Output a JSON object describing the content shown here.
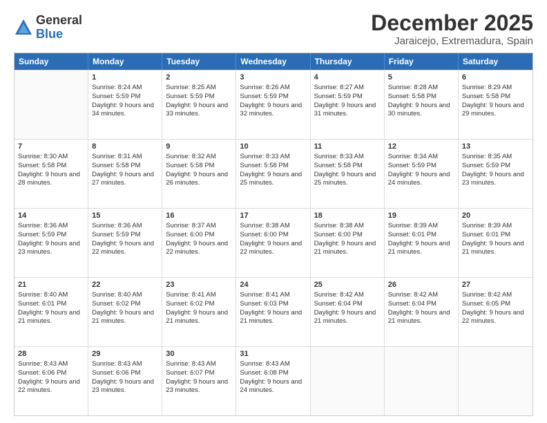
{
  "logo": {
    "general": "General",
    "blue": "Blue"
  },
  "title": "December 2025",
  "subtitle": "Jaraicejo, Extremadura, Spain",
  "days": [
    "Sunday",
    "Monday",
    "Tuesday",
    "Wednesday",
    "Thursday",
    "Friday",
    "Saturday"
  ],
  "weeks": [
    [
      {
        "day": "",
        "sunrise": "",
        "sunset": "",
        "daylight": ""
      },
      {
        "day": "1",
        "sunrise": "Sunrise: 8:24 AM",
        "sunset": "Sunset: 5:59 PM",
        "daylight": "Daylight: 9 hours and 34 minutes."
      },
      {
        "day": "2",
        "sunrise": "Sunrise: 8:25 AM",
        "sunset": "Sunset: 5:59 PM",
        "daylight": "Daylight: 9 hours and 33 minutes."
      },
      {
        "day": "3",
        "sunrise": "Sunrise: 8:26 AM",
        "sunset": "Sunset: 5:59 PM",
        "daylight": "Daylight: 9 hours and 32 minutes."
      },
      {
        "day": "4",
        "sunrise": "Sunrise: 8:27 AM",
        "sunset": "Sunset: 5:59 PM",
        "daylight": "Daylight: 9 hours and 31 minutes."
      },
      {
        "day": "5",
        "sunrise": "Sunrise: 8:28 AM",
        "sunset": "Sunset: 5:58 PM",
        "daylight": "Daylight: 9 hours and 30 minutes."
      },
      {
        "day": "6",
        "sunrise": "Sunrise: 8:29 AM",
        "sunset": "Sunset: 5:58 PM",
        "daylight": "Daylight: 9 hours and 29 minutes."
      }
    ],
    [
      {
        "day": "7",
        "sunrise": "Sunrise: 8:30 AM",
        "sunset": "Sunset: 5:58 PM",
        "daylight": "Daylight: 9 hours and 28 minutes."
      },
      {
        "day": "8",
        "sunrise": "Sunrise: 8:31 AM",
        "sunset": "Sunset: 5:58 PM",
        "daylight": "Daylight: 9 hours and 27 minutes."
      },
      {
        "day": "9",
        "sunrise": "Sunrise: 8:32 AM",
        "sunset": "Sunset: 5:58 PM",
        "daylight": "Daylight: 9 hours and 26 minutes."
      },
      {
        "day": "10",
        "sunrise": "Sunrise: 8:33 AM",
        "sunset": "Sunset: 5:58 PM",
        "daylight": "Daylight: 9 hours and 25 minutes."
      },
      {
        "day": "11",
        "sunrise": "Sunrise: 8:33 AM",
        "sunset": "Sunset: 5:58 PM",
        "daylight": "Daylight: 9 hours and 25 minutes."
      },
      {
        "day": "12",
        "sunrise": "Sunrise: 8:34 AM",
        "sunset": "Sunset: 5:59 PM",
        "daylight": "Daylight: 9 hours and 24 minutes."
      },
      {
        "day": "13",
        "sunrise": "Sunrise: 8:35 AM",
        "sunset": "Sunset: 5:59 PM",
        "daylight": "Daylight: 9 hours and 23 minutes."
      }
    ],
    [
      {
        "day": "14",
        "sunrise": "Sunrise: 8:36 AM",
        "sunset": "Sunset: 5:59 PM",
        "daylight": "Daylight: 9 hours and 23 minutes."
      },
      {
        "day": "15",
        "sunrise": "Sunrise: 8:36 AM",
        "sunset": "Sunset: 5:59 PM",
        "daylight": "Daylight: 9 hours and 22 minutes."
      },
      {
        "day": "16",
        "sunrise": "Sunrise: 8:37 AM",
        "sunset": "Sunset: 6:00 PM",
        "daylight": "Daylight: 9 hours and 22 minutes."
      },
      {
        "day": "17",
        "sunrise": "Sunrise: 8:38 AM",
        "sunset": "Sunset: 6:00 PM",
        "daylight": "Daylight: 9 hours and 22 minutes."
      },
      {
        "day": "18",
        "sunrise": "Sunrise: 8:38 AM",
        "sunset": "Sunset: 6:00 PM",
        "daylight": "Daylight: 9 hours and 21 minutes."
      },
      {
        "day": "19",
        "sunrise": "Sunrise: 8:39 AM",
        "sunset": "Sunset: 6:01 PM",
        "daylight": "Daylight: 9 hours and 21 minutes."
      },
      {
        "day": "20",
        "sunrise": "Sunrise: 8:39 AM",
        "sunset": "Sunset: 6:01 PM",
        "daylight": "Daylight: 9 hours and 21 minutes."
      }
    ],
    [
      {
        "day": "21",
        "sunrise": "Sunrise: 8:40 AM",
        "sunset": "Sunset: 6:01 PM",
        "daylight": "Daylight: 9 hours and 21 minutes."
      },
      {
        "day": "22",
        "sunrise": "Sunrise: 8:40 AM",
        "sunset": "Sunset: 6:02 PM",
        "daylight": "Daylight: 9 hours and 21 minutes."
      },
      {
        "day": "23",
        "sunrise": "Sunrise: 8:41 AM",
        "sunset": "Sunset: 6:02 PM",
        "daylight": "Daylight: 9 hours and 21 minutes."
      },
      {
        "day": "24",
        "sunrise": "Sunrise: 8:41 AM",
        "sunset": "Sunset: 6:03 PM",
        "daylight": "Daylight: 9 hours and 21 minutes."
      },
      {
        "day": "25",
        "sunrise": "Sunrise: 8:42 AM",
        "sunset": "Sunset: 6:04 PM",
        "daylight": "Daylight: 9 hours and 21 minutes."
      },
      {
        "day": "26",
        "sunrise": "Sunrise: 8:42 AM",
        "sunset": "Sunset: 6:04 PM",
        "daylight": "Daylight: 9 hours and 21 minutes."
      },
      {
        "day": "27",
        "sunrise": "Sunrise: 8:42 AM",
        "sunset": "Sunset: 6:05 PM",
        "daylight": "Daylight: 9 hours and 22 minutes."
      }
    ],
    [
      {
        "day": "28",
        "sunrise": "Sunrise: 8:43 AM",
        "sunset": "Sunset: 6:06 PM",
        "daylight": "Daylight: 9 hours and 22 minutes."
      },
      {
        "day": "29",
        "sunrise": "Sunrise: 8:43 AM",
        "sunset": "Sunset: 6:06 PM",
        "daylight": "Daylight: 9 hours and 23 minutes."
      },
      {
        "day": "30",
        "sunrise": "Sunrise: 8:43 AM",
        "sunset": "Sunset: 6:07 PM",
        "daylight": "Daylight: 9 hours and 23 minutes."
      },
      {
        "day": "31",
        "sunrise": "Sunrise: 8:43 AM",
        "sunset": "Sunset: 6:08 PM",
        "daylight": "Daylight: 9 hours and 24 minutes."
      },
      {
        "day": "",
        "sunrise": "",
        "sunset": "",
        "daylight": ""
      },
      {
        "day": "",
        "sunrise": "",
        "sunset": "",
        "daylight": ""
      },
      {
        "day": "",
        "sunrise": "",
        "sunset": "",
        "daylight": ""
      }
    ]
  ]
}
